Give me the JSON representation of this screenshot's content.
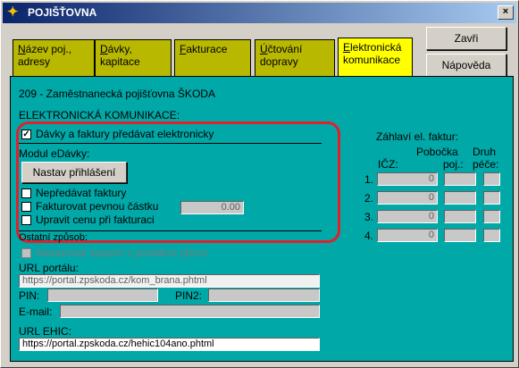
{
  "window": {
    "title": "POJIŠŤOVNA",
    "close_label": "×"
  },
  "tabs": [
    {
      "key": "N",
      "rest": "ázev poj.,",
      "line2": "adresy",
      "active": false
    },
    {
      "key": "D",
      "rest": "ávky,",
      "line2": "kapitace",
      "active": false
    },
    {
      "key": "F",
      "rest": "akturace",
      "line2": "",
      "active": false
    },
    {
      "key": "Ú",
      "rest": "čtování",
      "line2": "dopravy",
      "active": false
    },
    {
      "key": "E",
      "rest": "lektronická",
      "line2": "komunikace",
      "active": true
    }
  ],
  "buttons": {
    "close": "Zavři",
    "help": "Nápověda"
  },
  "insurer": "209 - Zaměstnanecká pojišťovna ŠKODA",
  "section_title": "ELEKTRONICKÁ KOMUNIKACE:",
  "electronic_checkbox": {
    "label": "Dávky a faktury předávat elektronicky",
    "checked": true
  },
  "edavky": {
    "title": "Modul eDávky:",
    "login_button": "Nastav přihlášení",
    "no_invoices": {
      "label": "Nepředávat faktury",
      "checked": false
    },
    "fixed_amount": {
      "label": "Fakturovat pevnou částku",
      "checked": false,
      "value": "0.00"
    },
    "adjust_price": {
      "label": "Upravit cenu při fakturaci",
      "checked": false
    }
  },
  "communication": {
    "title": "Ostatní způsob:",
    "direct_portal": {
      "label": "Navazovat spojení s portálem přímo",
      "checked": false
    },
    "url_label": "URL portálu:",
    "url_value": "https://portal.zpskoda.cz/kom_brana.phtml",
    "pin_label": "PIN:",
    "pin2_label": "PIN2:",
    "email_label": "E-mail:",
    "ehic_label": "URL EHIC:",
    "ehic_value": "https://portal.zpskoda.cz/hehic104ano.phtml"
  },
  "invoice_header": {
    "title": "Záhlaví el. faktur:",
    "col_icz": "IČZ:",
    "col_branch_1": "Pobočka",
    "col_branch_2": "poj.:",
    "col_care_1": "Druh",
    "col_care_2": "péče:",
    "rows": [
      {
        "num": "1.",
        "icz": "0"
      },
      {
        "num": "2.",
        "icz": "0"
      },
      {
        "num": "3.",
        "icz": "0"
      },
      {
        "num": "4.",
        "icz": "0"
      }
    ]
  },
  "colors": {
    "panel": "#00a8a8",
    "tab_active": "#ffff00",
    "tab_inactive": "#b8b800",
    "highlight": "#e0202a"
  }
}
